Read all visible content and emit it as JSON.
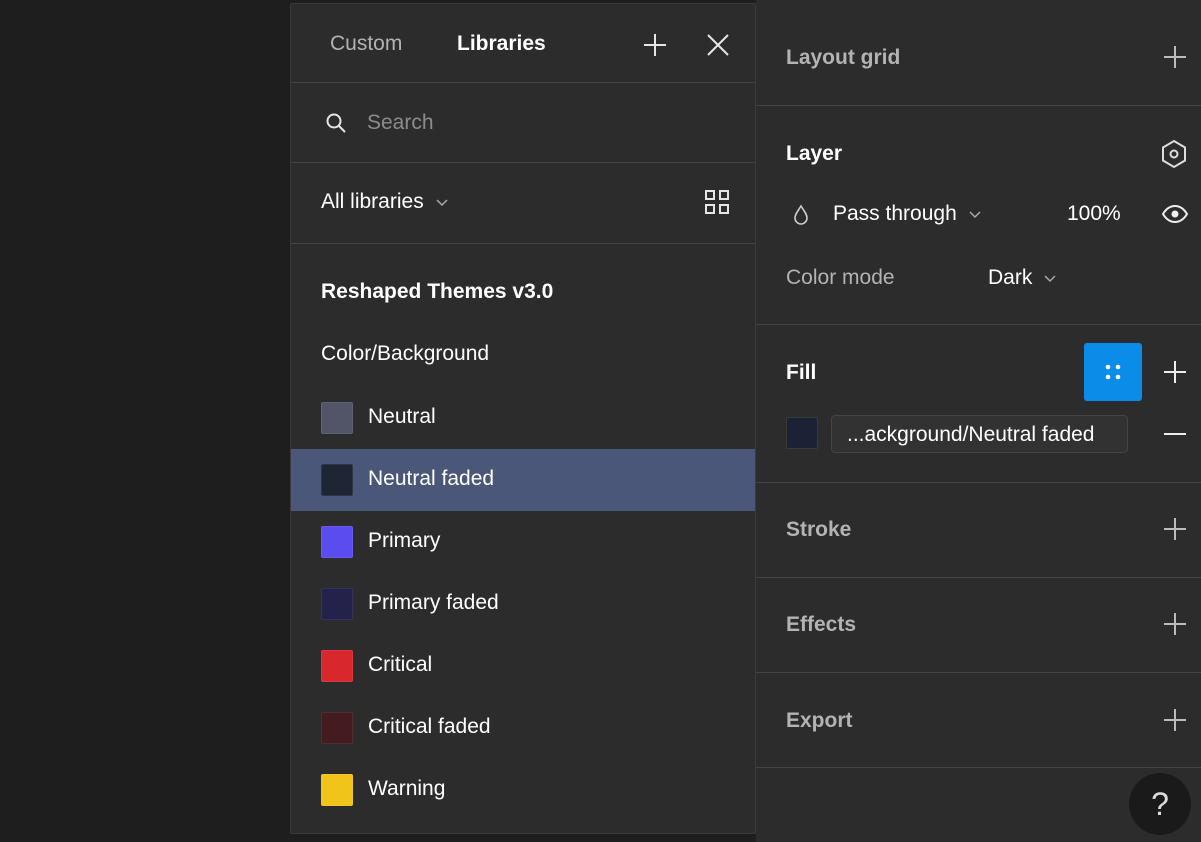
{
  "popover": {
    "tabs": [
      {
        "label": "Custom",
        "active": false
      },
      {
        "label": "Libraries",
        "active": true
      }
    ],
    "search_placeholder": "Search",
    "library_filter": "All libraries",
    "library_name": "Reshaped Themes v3.0",
    "group_name": "Color/Background",
    "swatches": [
      {
        "label": "Neutral",
        "color": "#525567",
        "selected": false
      },
      {
        "label": "Neutral faded",
        "color": "#1e2635",
        "selected": true
      },
      {
        "label": "Primary",
        "color": "#5b4cf0",
        "selected": false
      },
      {
        "label": "Primary faded",
        "color": "#24224a",
        "selected": false
      },
      {
        "label": "Critical",
        "color": "#d9272e",
        "selected": false
      },
      {
        "label": "Critical faded",
        "color": "#441c1f",
        "selected": false
      },
      {
        "label": "Warning",
        "color": "#f0c419",
        "selected": false
      }
    ]
  },
  "panel": {
    "layout_grid": {
      "title": "Layout grid"
    },
    "layer": {
      "title": "Layer",
      "blend_mode": "Pass through",
      "opacity": "100%",
      "color_mode_label": "Color mode",
      "color_mode_value": "Dark"
    },
    "fill": {
      "title": "Fill",
      "style_name": "...ackground/Neutral faded",
      "swatch_color": "#1c2235"
    },
    "stroke": {
      "title": "Stroke"
    },
    "effects": {
      "title": "Effects"
    },
    "export": {
      "title": "Export"
    }
  },
  "help": {
    "label": "?"
  },
  "colors": {
    "panel_bg": "#2c2c2c",
    "canvas_bg": "#1e1e1e",
    "selection": "#4a5778",
    "accent": "#0c8ce9"
  }
}
